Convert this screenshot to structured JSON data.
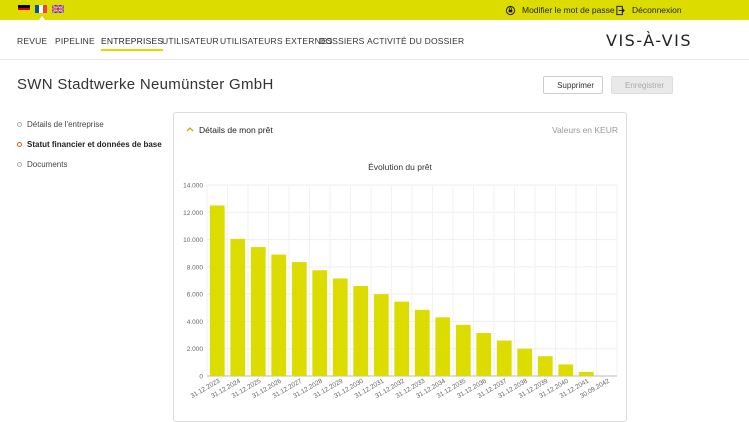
{
  "topbar": {
    "languages": [
      "de",
      "fr",
      "en"
    ],
    "change_password": "Modifier le mot de passe",
    "logout": "Déconnexion"
  },
  "nav": {
    "items": [
      "REVUE",
      "PIPELINE",
      "ENTREPRISES",
      "UTILISATEUR",
      "UTILISATEURS EXTERNES",
      "DOSSIERS",
      "ACTIVITÉ DU DOSSIER"
    ],
    "active": "ENTREPRISES",
    "logo": "VIS-À-VIS"
  },
  "page": {
    "title": "SWN Stadtwerke Neumünster GmbH",
    "delete_label": "Supprimer",
    "save_label": "Enregistrer"
  },
  "sidebar": {
    "items": [
      {
        "label": "Détails de l'entreprise",
        "active": false
      },
      {
        "label": "Statut financier et données de base",
        "active": true
      },
      {
        "label": "Documents",
        "active": false
      }
    ]
  },
  "panel": {
    "title": "Détails de mon prêt",
    "unit": "Valeurs en KEUR"
  },
  "colors": {
    "accent": "#dcdc00",
    "active_dot": "#e05a1a",
    "delete_icon": "#e05a1a"
  },
  "chart_data": {
    "type": "bar",
    "title": "Évolution du prêt",
    "categories": [
      "31.12.2023",
      "31.12.2024",
      "31.12.2025",
      "31.12.2026",
      "31.12.2027",
      "31.12.2028",
      "31.12.2029",
      "31.12.2030",
      "31.12.2031",
      "31.12.2032",
      "31.12.2033",
      "31.12.2034",
      "31.12.2035",
      "31.12.2036",
      "31.12.2037",
      "31.12.2038",
      "31.12.2039",
      "31.12.2040",
      "31.12.2041",
      "30.09.2042"
    ],
    "values": [
      12500,
      10050,
      9450,
      8900,
      8350,
      7750,
      7150,
      6600,
      6000,
      5450,
      4850,
      4300,
      3750,
      3150,
      2600,
      2000,
      1450,
      850,
      300,
      0
    ],
    "ylim": [
      0,
      14000
    ],
    "yticks": [
      0,
      2000,
      4000,
      6000,
      8000,
      10000,
      12000,
      14000
    ],
    "ytick_labels": [
      "0",
      "2.000",
      "4.000",
      "6.000",
      "8.000",
      "10.000",
      "12.000",
      "14.000"
    ],
    "grid": true,
    "color": "#dcdc00"
  }
}
